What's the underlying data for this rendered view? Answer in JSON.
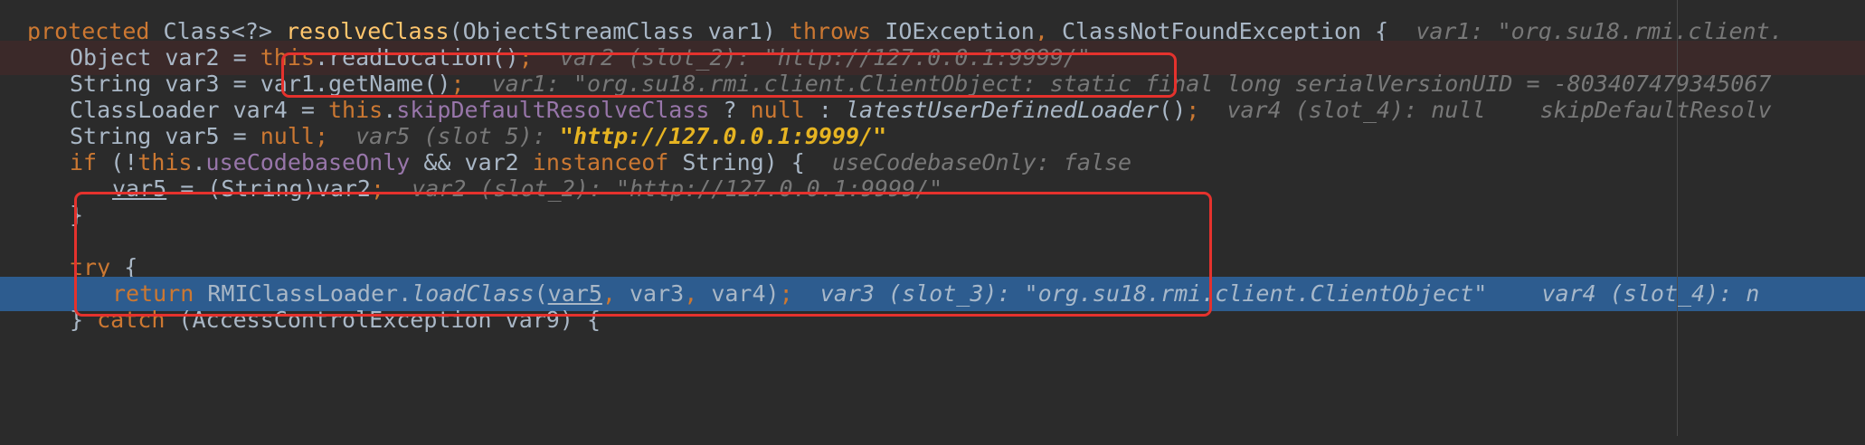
{
  "editor": {
    "lines": [
      {
        "kw": "protected",
        "t1": " Class<?> ",
        "fn": "resolveClass",
        "t2": "(ObjectStreamClass var1) ",
        "kw2": "throws",
        "t3": " IOException",
        "comma": ",",
        "t4": " ClassNotFoundException {",
        "hint": "var1: \"org.su18.rmi.client."
      },
      {
        "t1": "Object var2 = ",
        "kw": "this",
        "t2": ".readLocation()",
        "semi": ";",
        "hint": "var2 (slot_2): \"http://127.0.0.1:9999/\""
      },
      {
        "t1": "String var3 = var1.getName()",
        "semi": ";",
        "hint": "var1: \"org.su18.rmi.client.ClientObject: static final long serialVersionUID = -803407479345067"
      },
      {
        "t1": "ClassLoader var4 = ",
        "kw": "this",
        "dot": ".",
        "field": "skipDefaultResolveClass",
        "t2": " ? ",
        "kw2": "null",
        "t3": " : ",
        "it": "latestUserDefinedLoader",
        "t4": "()",
        "semi": ";",
        "hint": "var4 (slot_4): null    skipDefaultResolv"
      },
      {
        "t1": "String var5 = ",
        "kw": "null",
        "semi": ";",
        "hint": "var5 (slot 5): ",
        "hint_val": "\"http://127.0.0.1:9999/\""
      },
      {
        "kw": "if",
        "t1": " (!",
        "kw2": "this",
        "dot": ".",
        "field": "useCodebaseOnly",
        "t2": " && var2 ",
        "kw3": "instanceof",
        "t3": " String) {",
        "hint": "useCodebaseOnly: false"
      },
      {
        "ul": "var5",
        "t1": " = (String)var2",
        "semi": ";",
        "hint": "var2 (slot_2): \"http://127.0.0.1:9999/\""
      },
      {
        "t1": "}"
      },
      {
        "kw": "try",
        "t1": " {"
      },
      {
        "kw": "return",
        "t1": " RMIClassLoader.",
        "it": "loadClass",
        "t2": "(",
        "ul": "var5",
        "comma": ",",
        "t3": " var3",
        "comma2": ",",
        "t4": " var4)",
        "semi": ";",
        "hint": "var3 (slot_3): \"org.su18.rmi.client.ClientObject\"    var4 (slot_4): n"
      },
      {
        "t1": "} ",
        "kw": "catch",
        "t2": " (AccessControlException var9) {"
      }
    ]
  },
  "colors": {
    "background": "#2b2b2b",
    "keyword": "#cc7832",
    "method": "#ffc66d",
    "field": "#9876aa",
    "execution_line": "#2d5c8f",
    "highlight_box": "#e5322d"
  }
}
